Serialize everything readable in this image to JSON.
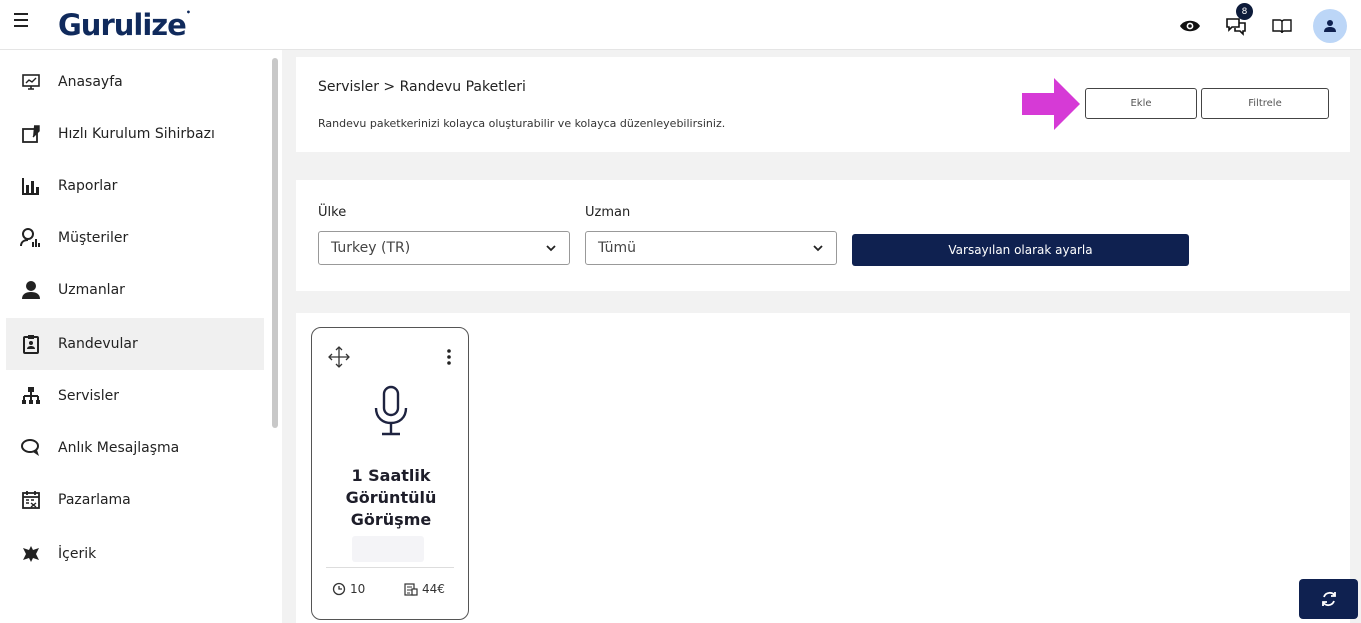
{
  "brand": {
    "name": "Gurulize"
  },
  "topbar": {
    "notification_count": "8"
  },
  "sidebar": {
    "items": [
      {
        "label": "Anasayfa",
        "icon": "dashboard-icon"
      },
      {
        "label": "Hızlı Kurulum Sihirbazı",
        "icon": "wizard-icon"
      },
      {
        "label": "Raporlar",
        "icon": "bar-chart-icon"
      },
      {
        "label": "Müşteriler",
        "icon": "customers-icon"
      },
      {
        "label": "Uzmanlar",
        "icon": "expert-icon"
      },
      {
        "label": "Randevular",
        "icon": "clipboard-icon"
      },
      {
        "label": "Servisler",
        "icon": "sitemap-icon"
      },
      {
        "label": "Anlık Mesajlaşma",
        "icon": "chat-icon"
      },
      {
        "label": "Pazarlama",
        "icon": "calendar-icon"
      },
      {
        "label": "İçerik",
        "icon": "content-icon"
      }
    ],
    "active": "Randevular"
  },
  "header": {
    "breadcrumb": "Servisler  >  Randevu Paketleri",
    "subtitle": "Randevu paketkerinizi kolayca oluşturabilir ve kolayca düzenleyebilirsiniz.",
    "add_label": "Ekle",
    "filter_label": "Filtrele"
  },
  "filters": {
    "country_label": "Ülke",
    "country_value": "Turkey (TR)",
    "expert_label": "Uzman",
    "expert_value": "Tümü",
    "set_default_label": "Varsayılan olarak ayarla"
  },
  "packages": [
    {
      "title_lines": [
        "1 Saatlik",
        "Görüntülü",
        "Görüşme"
      ],
      "icon": "microphone-icon",
      "duration": "10",
      "price": "44€"
    }
  ],
  "colors": {
    "primary": "#0f2150",
    "accent_arrow": "#d63ad6",
    "avatar_bg": "#bcd6f7"
  }
}
